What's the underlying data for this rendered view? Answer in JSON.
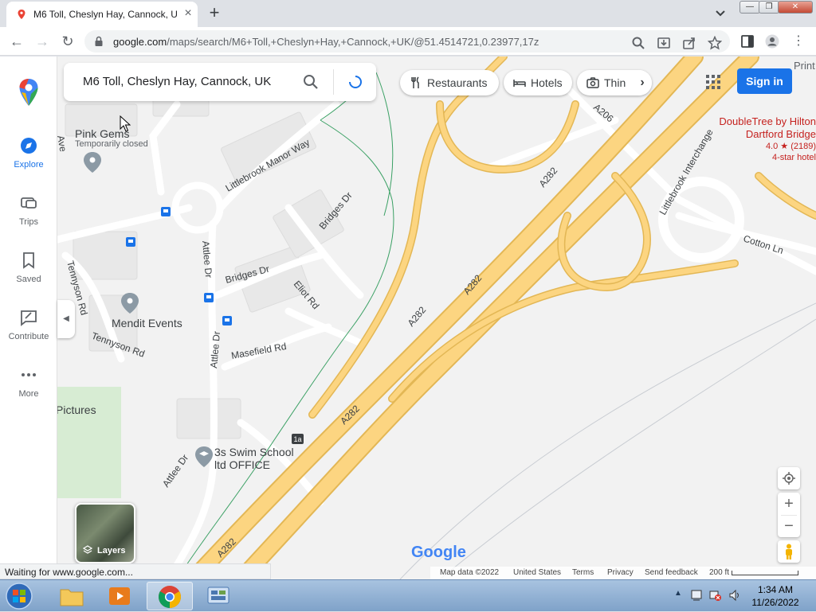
{
  "browser": {
    "tab_title": "M6 Toll, Cheslyn Hay, Cannock, U",
    "url_host": "google.com",
    "url_path": "/maps/search/M6+Toll,+Cheslyn+Hay,+Cannock,+UK/@51.4514721,0.23977,17z",
    "status_text": "Waiting for www.google.com..."
  },
  "sidebar": {
    "items": [
      {
        "label": "Explore"
      },
      {
        "label": "Trips"
      },
      {
        "label": "Saved"
      },
      {
        "label": "Contribute"
      },
      {
        "label": "More"
      }
    ]
  },
  "search": {
    "query": "M6 Toll, Cheslyn Hay, Cannock, UK"
  },
  "chips": [
    {
      "label": "Restaurants",
      "icon": "fork-knife-icon"
    },
    {
      "label": "Hotels",
      "icon": "bed-icon"
    },
    {
      "label": "Thin",
      "icon": "camera-icon"
    }
  ],
  "header": {
    "signin_label": "Sign in",
    "print_label": "Print"
  },
  "map": {
    "labels": {
      "pink_gems": "Pink Gems",
      "temp_closed": "Temporarily closed",
      "littlebrook_manor": "Littlebrook Manor Way",
      "bridges_dr_a": "Bridges Dr",
      "bridges_dr_b": "Bridges Dr",
      "tennyson_rd_a": "Tennyson Rd",
      "tennyson_rd_b": "Tennyson Rd",
      "attlee_dr_a": "Attlee Dr",
      "attlee_dr_b": "Attlee Dr",
      "attlee_dr_c": "Attlee Dr",
      "eliot_rd": "Eliot Rd",
      "masefield_rd": "Masefield Rd",
      "mendit": "Mendit Events",
      "pictures": "Pictures",
      "swim_1": "3s Swim School",
      "swim_2": "ltd OFFICE",
      "ave": "Ave",
      "a206": "A206",
      "littlebrook_interchange": "Littlebrook Interchange",
      "cotton_ln": "Cotton Ln",
      "a282_1": "A282",
      "a282_2": "A282",
      "a282_3": "A282",
      "a282_4": "A282",
      "a282_5": "A282",
      "junction": "1a"
    },
    "hotel": {
      "name_1": "DoubleTree by Hilton",
      "name_2": "Dartford Bridge",
      "rating": "4.0 ★ (2189)",
      "category": "4-star hotel"
    },
    "layers_label": "Layers",
    "logo": "Google"
  },
  "footer": {
    "map_data": "Map data ©2022",
    "region": "United States",
    "terms": "Terms",
    "privacy": "Privacy",
    "feedback": "Send feedback",
    "scale": "200 ft"
  },
  "taskbar": {
    "time": "1:34 AM",
    "date": "11/26/2022"
  },
  "colors": {
    "road_major": "#fcd581",
    "road_major_outline": "#e3b755",
    "hotel_pink": "#c5221f",
    "brand_blue": "#1a73e8"
  }
}
